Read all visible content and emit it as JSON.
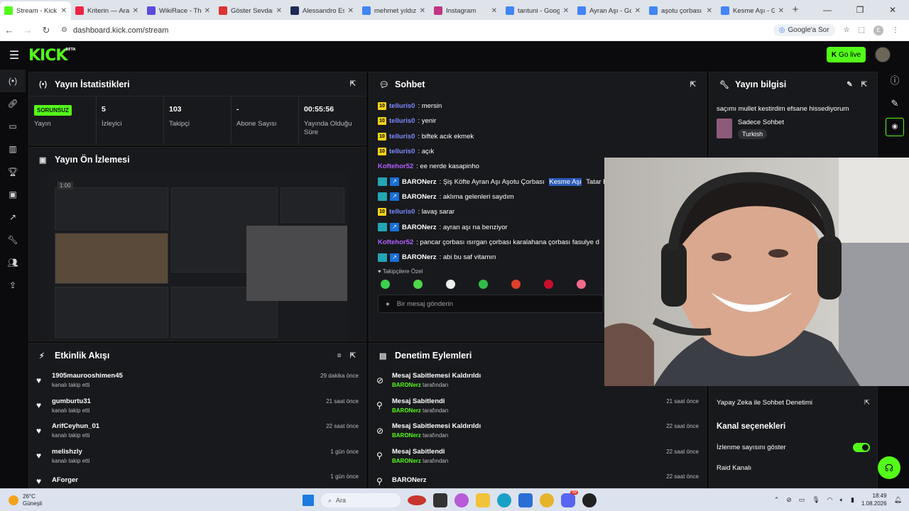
{
  "browser": {
    "tabs": [
      {
        "label": "Stream - Kick D",
        "fav": "#53fc18",
        "active": true
      },
      {
        "label": "Kriterin — Ara",
        "fav": "#e24"
      },
      {
        "label": "WikiRace - The",
        "fav": "#5b4bdb"
      },
      {
        "label": "Göster Sevdan",
        "fav": "#d33"
      },
      {
        "label": "Alessandro Esp",
        "fav": "#1e2a55"
      },
      {
        "label": "mehmet yıldız",
        "fav": "#4285f4"
      },
      {
        "label": "Instagram",
        "fav": "#c13584"
      },
      {
        "label": "tantuni - Goog",
        "fav": "#4285f4"
      },
      {
        "label": "Ayran Aşı - Go",
        "fav": "#4285f4"
      },
      {
        "label": "aşotu çorbası",
        "fav": "#4285f4"
      },
      {
        "label": "Kesme Aşı - Go",
        "fav": "#4285f4"
      }
    ],
    "url": "dashboard.kick.com/stream",
    "google_btn": "Google'a Sor",
    "profile_initial": "E"
  },
  "header": {
    "logo": "KICK",
    "beta": "BETA",
    "go_live": "Go live"
  },
  "stats_panel": {
    "title": "Yayın İstatistikleri",
    "status_badge": "SORUNSUZ",
    "items": [
      {
        "value": "",
        "label": "Yayın"
      },
      {
        "value": "5",
        "label": "İzleyici"
      },
      {
        "value": "103",
        "label": "Takipçi"
      },
      {
        "value": "-",
        "label": "Abone Sayısı"
      },
      {
        "value": "00:55:56",
        "label": "Yayında Olduğu Süre"
      }
    ]
  },
  "preview_panel": {
    "title": "Yayın Ön İzlemesi",
    "timestamp": "1:00"
  },
  "activity_panel": {
    "title": "Etkinlik Akışı",
    "items": [
      {
        "name": "1905maurooshimen45",
        "sub": "kanalı takip etti",
        "time": "29 dakika önce"
      },
      {
        "name": "gumburtu31",
        "sub": "kanalı takip etti",
        "time": "21 saat önce"
      },
      {
        "name": "ArifCeyhun_01",
        "sub": "kanalı takip etti",
        "time": "22 saat önce"
      },
      {
        "name": "melishzly",
        "sub": "kanalı takip etti",
        "time": "1 gün önce"
      },
      {
        "name": "AForger",
        "sub": "",
        "time": "1 gün önce"
      }
    ]
  },
  "chat_panel": {
    "title": "Sohbet",
    "messages": [
      {
        "user": "telluris0",
        "badge": "10",
        "color": "blue",
        "text": ": mersin"
      },
      {
        "user": "telluris0",
        "badge": "10",
        "color": "blue",
        "text": ": yenir"
      },
      {
        "user": "telluris0",
        "badge": "10",
        "color": "blue",
        "text": ": biftek acık ekmek"
      },
      {
        "user": "telluris0",
        "badge": "10",
        "color": "blue",
        "text": ": açık"
      },
      {
        "user": "Koftehor52",
        "badge": "",
        "color": "purple",
        "text": ": ee nerde kasapinho"
      },
      {
        "user": "BARONerz",
        "badge": "mod",
        "color": "white",
        "text": ": Şiş Köfte Ayran Aşı Aşotu Çorbası ",
        "hl": "Kesme Aşı",
        "tail": " Tatar Bö"
      },
      {
        "user": "BARONerz",
        "badge": "mod",
        "color": "white",
        "text": ": aklıma gelenleri saydım"
      },
      {
        "user": "telluris0",
        "badge": "10",
        "color": "blue",
        "text": ": lavaş sarar"
      },
      {
        "user": "BARONerz",
        "badge": "mod",
        "color": "white",
        "text": ": ayran aşı na benziyor"
      },
      {
        "user": "Koftehor52",
        "badge": "",
        "color": "purple",
        "text": ": pancar çorbası ısırgan çorbası karalahana çorbası fasulye d"
      },
      {
        "user": "BARONerz",
        "badge": "mod",
        "color": "white",
        "text": ": abi bu saf vitamın"
      }
    ],
    "emote_label": "Takipçilere Özel",
    "emote_colors": [
      "#3ccf4e",
      "#4fd64a",
      "#eeeeee",
      "#2fbf49",
      "#e0402d",
      "#c8102e",
      "#f06b8a"
    ],
    "input_placeholder": "Bir mesaj gönderin"
  },
  "moderation_panel": {
    "title": "Denetim Eylemleri",
    "items": [
      {
        "action": "Mesaj Sabitlemesi Kaldırıldı",
        "by": "BARONerz",
        "suffix": "tarafından",
        "time": "",
        "icon": "unpin-icon"
      },
      {
        "action": "Mesaj Sabitlendi",
        "by": "BARONerz",
        "suffix": "tarafından",
        "time": "21 saat önce",
        "icon": "pin-icon"
      },
      {
        "action": "Mesaj Sabitlemesi Kaldırıldı",
        "by": "BARONerz",
        "suffix": "tarafından",
        "time": "22 saat önce",
        "icon": "unpin-icon"
      },
      {
        "action": "Mesaj Sabitlendi",
        "by": "BARONerz",
        "suffix": "tarafından",
        "time": "22 saat önce",
        "icon": "pin-icon"
      },
      {
        "action": "BARONerz",
        "by": "",
        "suffix": "",
        "time": "22 saat önce",
        "icon": "pin-icon"
      }
    ]
  },
  "info_panel": {
    "title": "Yayın bilgisi",
    "stream_title": "saçımı mullet kestirdim efsane hissediyorum",
    "category": "Sadece Sohbet",
    "language": "Turkish",
    "ai_moderation": "Yapay Zeka ile Sohbet Denetimi",
    "channel_options": "Kanal seçenekleri",
    "show_viewers": "İzlenme sayısını göster",
    "raid": "Raid Kanalı"
  },
  "taskbar": {
    "temp": "26°C",
    "weather": "Güneşli",
    "search": "Ara",
    "time": "18:49",
    "date": "1.08.2026",
    "notif_count": "99"
  },
  "colors": {
    "accent": "#53fc18",
    "panel": "#18191c",
    "bg": "#0b0b0d"
  }
}
